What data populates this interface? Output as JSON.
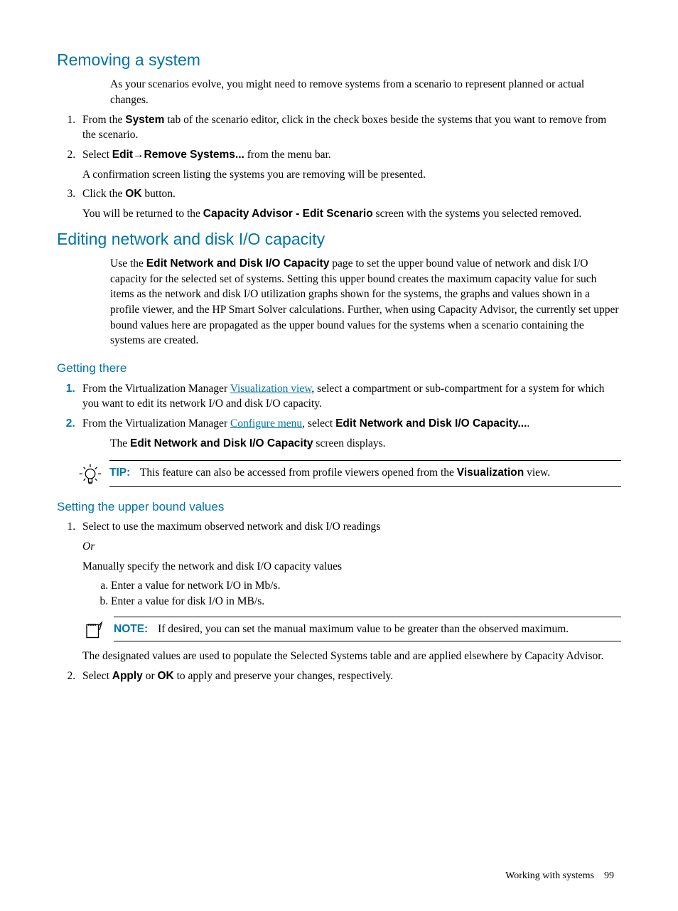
{
  "section1": {
    "heading": "Removing a system",
    "intro": "As your scenarios evolve, you might need to remove systems from a scenario to represent planned or actual changes.",
    "steps": [
      {
        "pre": "From the ",
        "bold": "System",
        "post": " tab of the scenario editor, click in the check boxes beside the systems that you want to remove from the scenario."
      },
      {
        "pre": "Select ",
        "bold1": "Edit",
        "arrow": "→",
        "bold2": "Remove Systems...",
        "post": " from the menu bar.",
        "after": "A confirmation screen listing the systems you are removing will be presented."
      },
      {
        "pre": "Click the ",
        "bold": "OK",
        "post": " button.",
        "after_pre": "You will be returned to the ",
        "after_bold": "Capacity Advisor - Edit Scenario",
        "after_post": " screen with the systems you selected removed."
      }
    ]
  },
  "section2": {
    "heading": "Editing network and disk I/O capacity",
    "intro_pre": "Use the ",
    "intro_bold": "Edit Network and Disk I/O Capacity",
    "intro_post": " page to set the upper bound value of network and disk I/O capacity for the selected set of systems. Setting this upper bound creates the maximum capacity value for such items as the network and disk I/O utilization graphs shown for the systems, the graphs and values shown in a profile viewer, and the HP Smart Solver calculations. Further, when using Capacity Advisor, the currently set upper bound values here are propagated as the upper bound values for the systems when a scenario containing the systems are created."
  },
  "getting_there": {
    "heading": "Getting there",
    "step1_pre": "From the Virtualization Manager ",
    "step1_link": "Visualization view",
    "step1_post": ", select a compartment or sub-compartment for a system for which you want to edit its network I/O and disk I/O capacity.",
    "step2_pre": "From the Virtualization Manager ",
    "step2_link": "Configure menu",
    "step2_mid": ", select ",
    "step2_bold": "Edit Network and Disk I/O Capacity...",
    "step2_post": ".",
    "display_pre": "The ",
    "display_bold": "Edit Network and Disk I/O Capacity",
    "display_post": " screen displays."
  },
  "tip": {
    "label": "TIP:",
    "pre": "This feature can also be accessed from profile viewers opened from the ",
    "bold": "Visualization",
    "post": " view."
  },
  "setting": {
    "heading": "Setting the upper bound values",
    "step1_a": "Select to use the maximum observed network and disk I/O readings",
    "or": "Or",
    "step1_b": "Manually specify the network and disk I/O capacity values",
    "sub_a": "Enter a value for network I/O in Mb/s.",
    "sub_b": "Enter a value for disk I/O in MB/s.",
    "after_note": "The designated values are used to populate the Selected Systems table and are applied elsewhere by Capacity Advisor.",
    "step2_pre": "Select ",
    "step2_b1": "Apply",
    "step2_mid": " or ",
    "step2_b2": "OK",
    "step2_post": " to apply and preserve your changes, respectively."
  },
  "note": {
    "label": "NOTE:",
    "text": "If desired, you can set the manual maximum value to be greater than the observed maximum."
  },
  "footer": {
    "section": "Working with systems",
    "page": "99"
  }
}
